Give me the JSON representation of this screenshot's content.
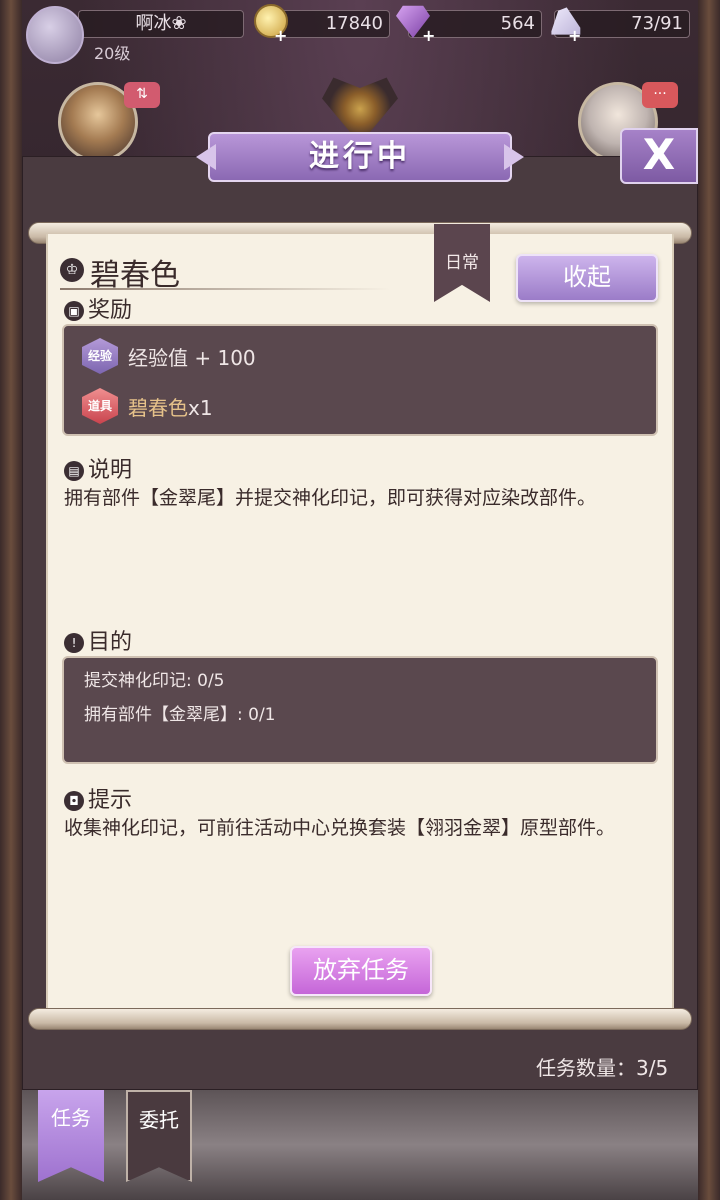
{
  "player": {
    "name": "啊冰❀",
    "level": "20级"
  },
  "resources": {
    "gold": "17840",
    "gems": "564",
    "stamina": "73/91"
  },
  "icons": {
    "gold": "coin-icon",
    "gem": "gem-icon",
    "stamina": "shoe-icon",
    "close": "close-icon",
    "crown": "crown-icon"
  },
  "dialog": {
    "title": "进行中",
    "close_label": "X",
    "quest_title": "碧春色",
    "ribbon": "日常",
    "collapse_label": "收起",
    "rewards_heading": "奖励",
    "rewards": [
      {
        "badge": "经验",
        "text": "经验值 + 100"
      },
      {
        "badge": "道具",
        "name": "碧春色",
        "qty": "x1"
      }
    ],
    "description_heading": "说明",
    "description": "拥有部件【金翠尾】并提交神化印记，即可获得对应染改部件。",
    "goal_heading": "目的",
    "goals": [
      "提交神化印记: 0/5",
      "拥有部件【金翠尾】: 0/1"
    ],
    "hint_heading": "提示",
    "hint": "收集神化印记，可前往活动中心兑换套装【翎羽金翠】原型部件。",
    "abandon_label": "放弃任务",
    "quest_count": "任务数量：3/5"
  },
  "tabs": [
    {
      "label": "任务",
      "active": true
    },
    {
      "label": "委托",
      "active": false
    }
  ],
  "colors": {
    "accent_purple": "#9b7cc8",
    "abandon_pink": "#c566d8",
    "paper": "#f7f1e4",
    "dark_box": "#5a484e"
  }
}
